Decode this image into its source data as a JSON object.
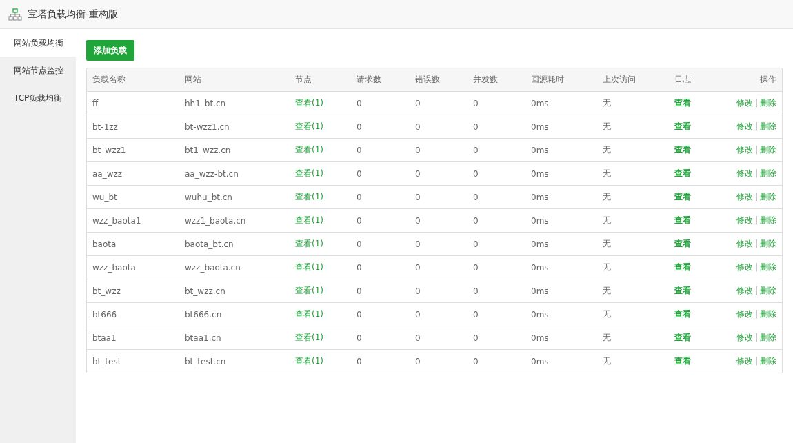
{
  "window": {
    "title": "宝塔负载均衡-重构版"
  },
  "sidebar": {
    "items": [
      {
        "label": "网站负载均衡",
        "selected": true
      },
      {
        "label": "网站节点监控",
        "selected": false
      },
      {
        "label": "TCP负载均衡",
        "selected": false
      }
    ]
  },
  "add_button": "添加负载",
  "table": {
    "columns": [
      "负载名称",
      "网站",
      "节点",
      "请求数",
      "错误数",
      "并发数",
      "回源耗时",
      "上次访问",
      "日志",
      "操作"
    ],
    "rows": [
      {
        "name": "ff",
        "site": "hh1_bt.cn",
        "nodes": "查看(1)",
        "requests": "0",
        "errors": "0",
        "concurrent": "0",
        "latency": "0ms",
        "last_visit": "无",
        "log": "查看",
        "edit": "修改",
        "separator": "|",
        "delete": "删除"
      },
      {
        "name": "bt-1zz",
        "site": "bt-wzz1.cn",
        "nodes": "查看(1)",
        "requests": "0",
        "errors": "0",
        "concurrent": "0",
        "latency": "0ms",
        "last_visit": "无",
        "log": "查看",
        "edit": "修改",
        "separator": "|",
        "delete": "删除"
      },
      {
        "name": "bt_wzz1",
        "site": "bt1_wzz.cn",
        "nodes": "查看(1)",
        "requests": "0",
        "errors": "0",
        "concurrent": "0",
        "latency": "0ms",
        "last_visit": "无",
        "log": "查看",
        "edit": "修改",
        "separator": "|",
        "delete": "删除"
      },
      {
        "name": "aa_wzz",
        "site": "aa_wzz-bt.cn",
        "nodes": "查看(1)",
        "requests": "0",
        "errors": "0",
        "concurrent": "0",
        "latency": "0ms",
        "last_visit": "无",
        "log": "查看",
        "edit": "修改",
        "separator": "|",
        "delete": "删除"
      },
      {
        "name": "wu_bt",
        "site": "wuhu_bt.cn",
        "nodes": "查看(1)",
        "requests": "0",
        "errors": "0",
        "concurrent": "0",
        "latency": "0ms",
        "last_visit": "无",
        "log": "查看",
        "edit": "修改",
        "separator": "|",
        "delete": "删除"
      },
      {
        "name": "wzz_baota1",
        "site": "wzz1_baota.cn",
        "nodes": "查看(1)",
        "requests": "0",
        "errors": "0",
        "concurrent": "0",
        "latency": "0ms",
        "last_visit": "无",
        "log": "查看",
        "edit": "修改",
        "separator": "|",
        "delete": "删除"
      },
      {
        "name": "baota",
        "site": "baota_bt.cn",
        "nodes": "查看(1)",
        "requests": "0",
        "errors": "0",
        "concurrent": "0",
        "latency": "0ms",
        "last_visit": "无",
        "log": "查看",
        "edit": "修改",
        "separator": "|",
        "delete": "删除"
      },
      {
        "name": "wzz_baota",
        "site": "wzz_baota.cn",
        "nodes": "查看(1)",
        "requests": "0",
        "errors": "0",
        "concurrent": "0",
        "latency": "0ms",
        "last_visit": "无",
        "log": "查看",
        "edit": "修改",
        "separator": "|",
        "delete": "删除"
      },
      {
        "name": "bt_wzz",
        "site": "bt_wzz.cn",
        "nodes": "查看(1)",
        "requests": "0",
        "errors": "0",
        "concurrent": "0",
        "latency": "0ms",
        "last_visit": "无",
        "log": "查看",
        "edit": "修改",
        "separator": "|",
        "delete": "删除"
      },
      {
        "name": "bt666",
        "site": "bt666.cn",
        "nodes": "查看(1)",
        "requests": "0",
        "errors": "0",
        "concurrent": "0",
        "latency": "0ms",
        "last_visit": "无",
        "log": "查看",
        "edit": "修改",
        "separator": "|",
        "delete": "删除"
      },
      {
        "name": "btaa1",
        "site": "btaa1.cn",
        "nodes": "查看(1)",
        "requests": "0",
        "errors": "0",
        "concurrent": "0",
        "latency": "0ms",
        "last_visit": "无",
        "log": "查看",
        "edit": "修改",
        "separator": "|",
        "delete": "删除"
      },
      {
        "name": "bt_test",
        "site": "bt_test.cn",
        "nodes": "查看(1)",
        "requests": "0",
        "errors": "0",
        "concurrent": "0",
        "latency": "0ms",
        "last_visit": "无",
        "log": "查看",
        "edit": "修改",
        "separator": "|",
        "delete": "删除"
      }
    ]
  }
}
